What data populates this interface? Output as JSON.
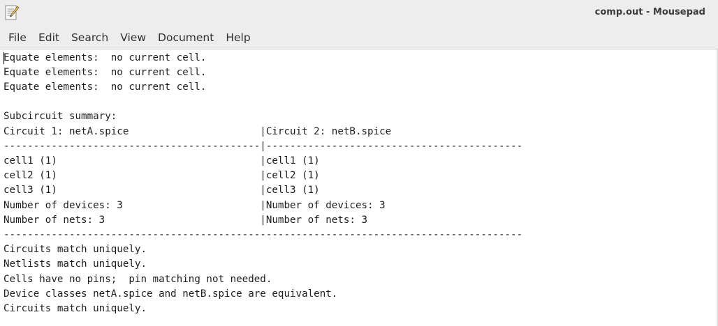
{
  "window": {
    "title": "comp.out - Mousepad",
    "icon": "text-editor-icon"
  },
  "menubar": {
    "items": [
      "File",
      "Edit",
      "Search",
      "View",
      "Document",
      "Help"
    ]
  },
  "document": {
    "lines": [
      "Equate elements:  no current cell.",
      "Equate elements:  no current cell.",
      "Equate elements:  no current cell.",
      "",
      "Subcircuit summary:",
      "Circuit 1: netA.spice                      |Circuit 2: netB.spice",
      "-------------------------------------------|-------------------------------------------",
      "cell1 (1)                                  |cell1 (1)",
      "cell2 (1)                                  |cell2 (1)",
      "cell3 (1)                                  |cell3 (1)",
      "Number of devices: 3                       |Number of devices: 3",
      "Number of nets: 3                          |Number of nets: 3",
      "---------------------------------------------------------------------------------------",
      "Circuits match uniquely.",
      "Netlists match uniquely.",
      "Cells have no pins;  pin matching not needed.",
      "Device classes netA.spice and netB.spice are equivalent.",
      "Circuits match uniquely."
    ]
  }
}
